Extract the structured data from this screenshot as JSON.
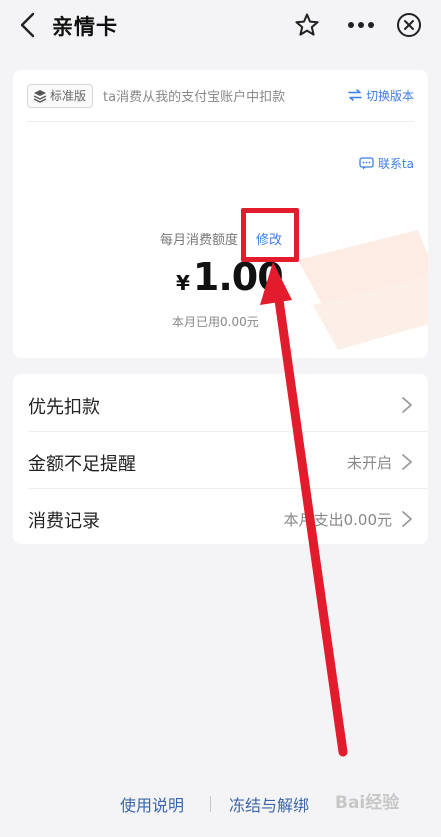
{
  "header": {
    "title": "亲情卡"
  },
  "card": {
    "version_tag": "标准版",
    "description": "ta消费从我的支付宝账户中扣款",
    "switch_version": "切换版本",
    "contact": "联系ta",
    "limit_label": "每月消费额度",
    "modify": "修改",
    "currency": "¥",
    "amount": "1.00",
    "used_this_month": "本月已用0.00元"
  },
  "list": {
    "items": [
      {
        "label": "优先扣款",
        "value": ""
      },
      {
        "label": "金额不足提醒",
        "value": "未开启"
      },
      {
        "label": "消费记录",
        "value": "本月支出0.00元"
      }
    ]
  },
  "footer": {
    "instructions": "使用说明",
    "freeze_unbind": "冻结与解绑"
  },
  "watermark": {
    "text": "Bai经验"
  },
  "colors": {
    "accent": "#3c7ee6",
    "annotation": "#e21c2c",
    "background": "#f4f4f6"
  }
}
